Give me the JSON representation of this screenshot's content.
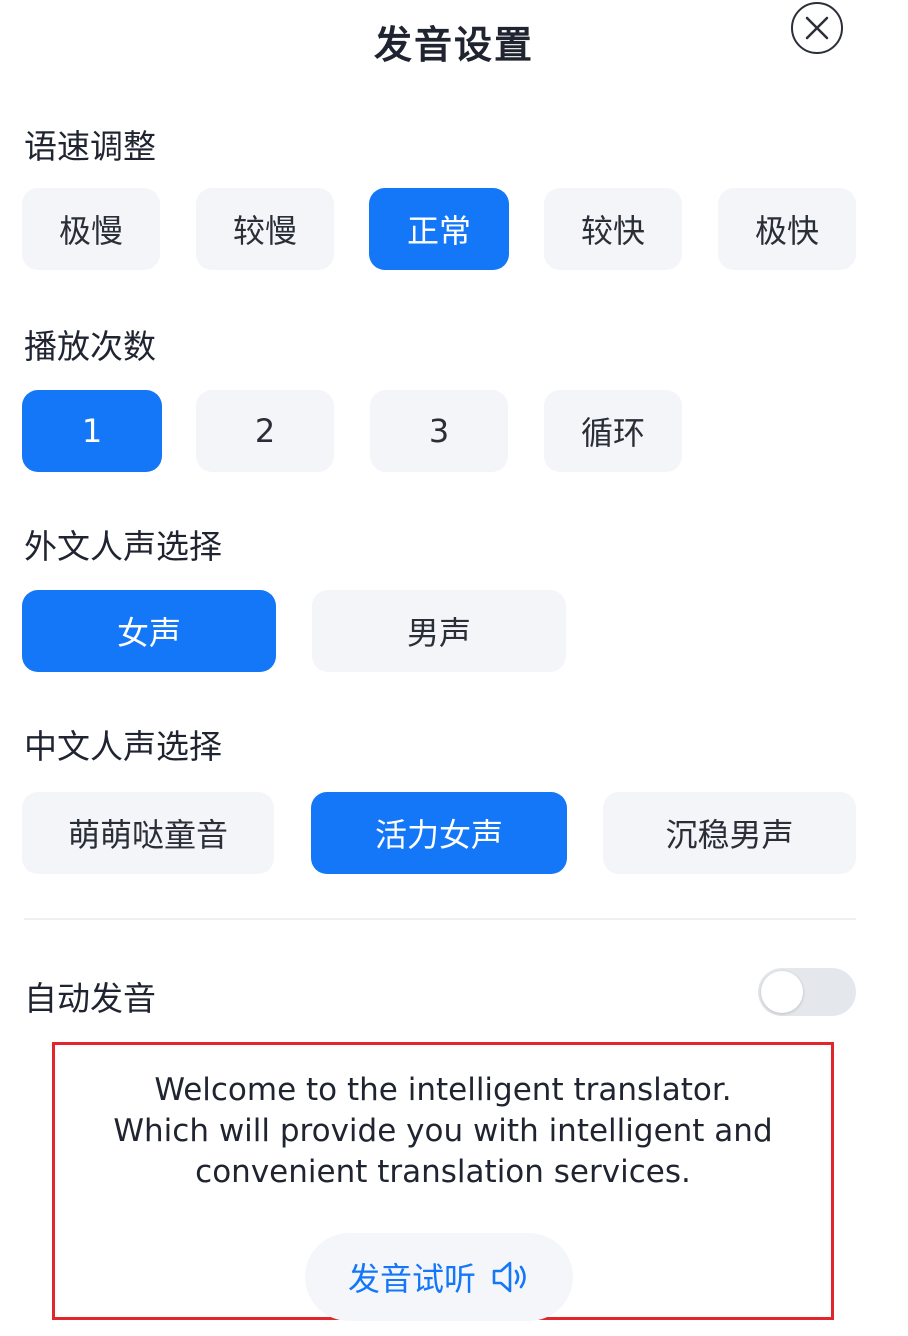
{
  "header": {
    "title": "发音设置",
    "close_icon": "close-circle-icon"
  },
  "speed": {
    "label": "语速调整",
    "options": [
      "极慢",
      "较慢",
      "正常",
      "较快",
      "极快"
    ],
    "selected": "正常"
  },
  "repeat": {
    "label": "播放次数",
    "options": [
      "1",
      "2",
      "3",
      "循环"
    ],
    "selected": "1"
  },
  "foreign_voice": {
    "label": "外文人声选择",
    "options": [
      "女声",
      "男声"
    ],
    "selected": "女声"
  },
  "chinese_voice": {
    "label": "中文人声选择",
    "options": [
      "萌萌哒童音",
      "活力女声",
      "沉稳男声"
    ],
    "selected": "活力女声"
  },
  "auto_play": {
    "label": "自动发音",
    "enabled": false
  },
  "demo": {
    "lines": [
      "Welcome to the intelligent translator.",
      "Which will provide you with intelligent and",
      "convenient translation services."
    ],
    "preview_label": "发音试听",
    "preview_icon": "speaker-icon"
  },
  "colors": {
    "accent": "#1477f8",
    "option_bg": "#f3f5f9",
    "highlight_border": "#e3262b"
  }
}
